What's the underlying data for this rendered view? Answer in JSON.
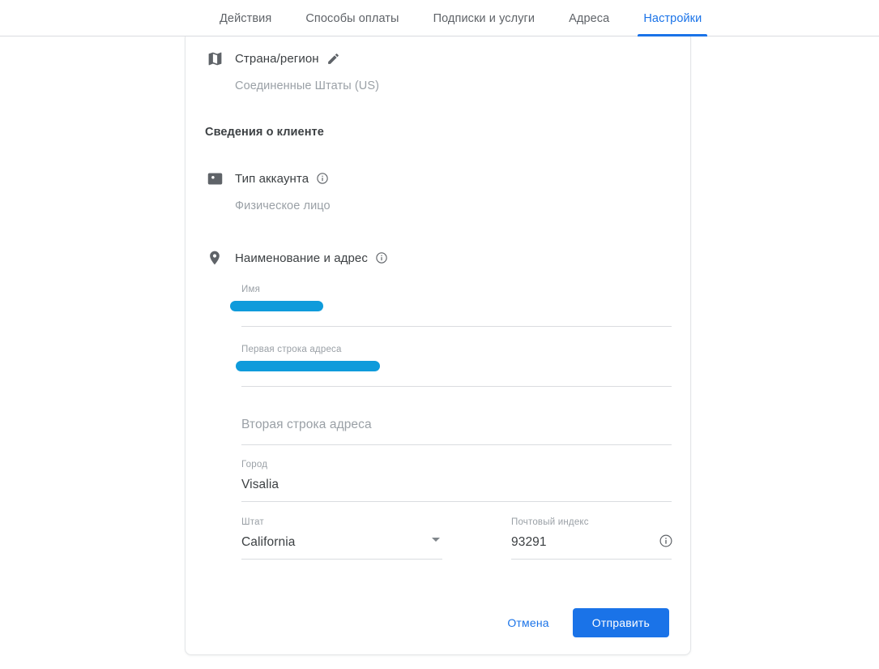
{
  "tabs": [
    {
      "label": "Действия",
      "active": false
    },
    {
      "label": "Способы оплаты",
      "active": false
    },
    {
      "label": "Подписки и услуги",
      "active": false
    },
    {
      "label": "Адреса",
      "active": false
    },
    {
      "label": "Настройки",
      "active": true
    }
  ],
  "country": {
    "icon": "map-icon",
    "title": "Страна/регион",
    "edit_icon": "pencil-edit-icon",
    "value": "Соединенные Штаты (US)"
  },
  "section": {
    "customer_info_heading": "Сведения о клиенте"
  },
  "account_type": {
    "icon": "contact-card-icon",
    "title": "Тип аккаунта",
    "info_icon": "info-icon",
    "value": "Физическое лицо"
  },
  "name_address": {
    "icon": "location-pin-icon",
    "title": "Наименование и адрес",
    "info_icon": "info-icon",
    "fields": {
      "name": {
        "label": "Имя",
        "value": "",
        "redacted": true
      },
      "address_line1": {
        "label": "Первая строка адреса",
        "value": "",
        "redacted": true
      },
      "address_line2": {
        "label": "",
        "placeholder": "Вторая строка адреса",
        "value": ""
      },
      "city": {
        "label": "Город",
        "value": "Visalia"
      },
      "state": {
        "label": "Штат",
        "value": "California",
        "arrow_icon": "chevron-down-icon"
      },
      "zip": {
        "label": "Почтовый индекс",
        "value": "93291",
        "info_icon": "info-icon"
      }
    }
  },
  "buttons": {
    "cancel": "Отмена",
    "submit": "Отправить"
  },
  "colors": {
    "accent": "#1a73e8",
    "redaction": "#0f9bdb",
    "muted": "#9aa0a6",
    "text": "#3c4043",
    "border": "#dadce0"
  }
}
